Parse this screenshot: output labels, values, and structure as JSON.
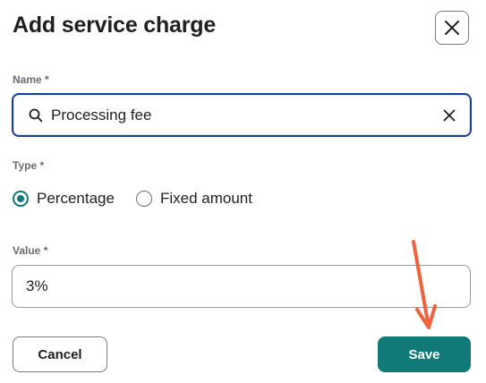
{
  "dialog": {
    "title": "Add service charge",
    "close_icon": "close-icon"
  },
  "name_field": {
    "label": "Name *",
    "value": "Processing fee",
    "leading_icon": "search-icon",
    "trailing_icon": "clear-icon"
  },
  "type_field": {
    "label": "Type *",
    "options": [
      {
        "label": "Percentage",
        "checked": true
      },
      {
        "label": "Fixed amount",
        "checked": false
      }
    ]
  },
  "value_field": {
    "label": "Value *",
    "value": "3%"
  },
  "actions": {
    "cancel_label": "Cancel",
    "save_label": "Save"
  },
  "colors": {
    "accent": "#0f7a78",
    "focus_border": "#1c3f96",
    "annotation_arrow": "#f0623f"
  },
  "annotation": {
    "icon": "arrow-down-icon",
    "points_to": "save-button"
  }
}
